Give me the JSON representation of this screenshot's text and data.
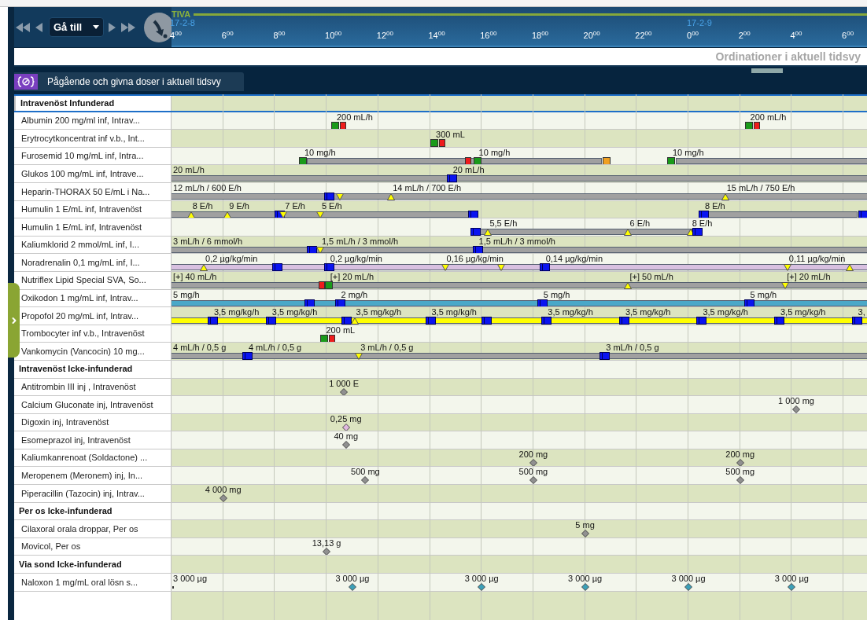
{
  "nav": {
    "goto": "Gå till"
  },
  "timeline": {
    "label": "TIVA",
    "hours": [
      {
        "text": "4$^{00}$",
        "date": "17-2-8"
      },
      {
        "text": "6$^{00}$"
      },
      {
        "text": "8$^{00}$"
      },
      {
        "text": "10$^{00}$"
      },
      {
        "text": "12$^{00}$"
      },
      {
        "text": "14$^{00}$"
      },
      {
        "text": "16$^{00}$"
      },
      {
        "text": "18$^{00}$"
      },
      {
        "text": "20$^{00}$"
      },
      {
        "text": "22$^{00}$"
      },
      {
        "text": "0$^{00}$",
        "date": "17-2-9"
      },
      {
        "text": "2$^{00}$"
      },
      {
        "text": "4$^{00}$"
      },
      {
        "text": "6$^{00}$"
      }
    ]
  },
  "panel_title": "Ordinationer i aktuell tidsvy",
  "tab": {
    "label": "Pågående och givna doser i aktuell tidsvy"
  },
  "sections": [
    {
      "title": "Intravenöst Infunderad",
      "selected": true,
      "rows": [
        {
          "name": "Albumin 200 mg/ml inf, Intrav...",
          "marks": [
            {
              "kind": "start",
              "text": "200 mL/h"
            },
            {
              "kind": "stop"
            },
            {
              "kind": "start",
              "text": "200 mL/h"
            },
            {
              "kind": "stop"
            }
          ]
        },
        {
          "name": "Erytrocytkoncentrat inf v.b., Int...",
          "marks": [
            {
              "kind": "start",
              "text": "300 mL"
            },
            {
              "kind": "stop"
            }
          ]
        },
        {
          "name": "Furosemid 10 mg/mL inf, Intra...",
          "bars": [
            {
              "color": "#a0a0a0"
            },
            {
              "color": "#a0a0a0"
            }
          ],
          "marks": [
            {
              "kind": "start",
              "text": "10 mg/h"
            },
            {
              "kind": "stop"
            },
            {
              "kind": "start",
              "text": "10 mg/h"
            },
            {
              "kind": "end"
            },
            {
              "kind": "start",
              "text": "10 mg/h"
            }
          ]
        },
        {
          "name": "Glukos 100 mg/mL inf, Intrave...",
          "lead": "20 mL/h",
          "bars": [
            {
              "color": "#a0a0a0"
            }
          ],
          "marks": [
            {
              "kind": "change",
              "text": "20 mL/h"
            }
          ]
        },
        {
          "name": "Heparin-THORAX 50 E/mL i Na...",
          "lead": "12 mL/h / 600 E/h",
          "bars": [
            {
              "color": "#a0a0a0"
            }
          ],
          "marks": [
            {
              "kind": "change"
            },
            {
              "kind": "down"
            },
            {
              "kind": "up",
              "text": "14 mL/h / 700 E/h"
            },
            {
              "kind": "up",
              "text": "15 mL/h / 750 E/h"
            }
          ]
        },
        {
          "name": "Humulin 1 E/mL inf, Intravenöst",
          "bars": [
            {
              "color": "#a0a0a0"
            },
            {
              "color": "#a0a0a0"
            }
          ],
          "marks": [
            {
              "kind": "up",
              "text": "8 E/h"
            },
            {
              "kind": "up",
              "text": "9 E/h"
            },
            {
              "kind": "change"
            },
            {
              "kind": "down",
              "text": "7 E/h"
            },
            {
              "kind": "down",
              "text": "5 E/h"
            },
            {
              "kind": "change"
            },
            {
              "kind": "change",
              "text": "8 E/h"
            },
            {
              "kind": "change"
            }
          ]
        },
        {
          "name": "Humulin 1 E/mL inf, Intravenöst",
          "bars": [
            {
              "color": "#a0a0a0"
            }
          ],
          "marks": [
            {
              "kind": "change"
            },
            {
              "kind": "up",
              "text": "5,5 E/h"
            },
            {
              "kind": "up",
              "text": "6 E/h"
            },
            {
              "kind": "up",
              "text": "8 E/h"
            },
            {
              "kind": "change"
            }
          ]
        },
        {
          "name": "Kaliumklorid 2 mmol/mL inf, I...",
          "lead": "3 mL/h / 6 mmol/h",
          "bars": [
            {
              "color": "#a0a0a0"
            }
          ],
          "marks": [
            {
              "kind": "change"
            },
            {
              "kind": "down",
              "text": "1,5 mL/h / 3 mmol/h"
            },
            {
              "kind": "change",
              "text": "1,5 mL/h / 3 mmol/h"
            }
          ]
        },
        {
          "name": "Noradrenalin 0,1 mg/mL inf, I...",
          "bars": [
            {
              "color": "#d8c0e0"
            }
          ],
          "marks": [
            {
              "kind": "up",
              "text": "0,2 µg/kg/min"
            },
            {
              "kind": "change"
            },
            {
              "kind": "change",
              "text": "0,2 µg/kg/min"
            },
            {
              "kind": "down",
              "text": "0,16 µg/kg/min"
            },
            {
              "kind": "down"
            },
            {
              "kind": "change",
              "text": "0,14 µg/kg/min"
            },
            {
              "kind": "down",
              "text": "0,11 µg/kg/min"
            },
            {
              "kind": "up"
            }
          ]
        },
        {
          "name": "Nutriflex Lipid Special SVA, So...",
          "lead": "[+] 40 mL/h",
          "bars": [
            {
              "color": "#a0a0a0"
            }
          ],
          "marks": [
            {
              "kind": "stop"
            },
            {
              "kind": "start",
              "text": "[+] 20 mL/h"
            },
            {
              "kind": "up",
              "text": "[+] 50 mL/h"
            },
            {
              "kind": "down",
              "text": "[+] 20 mL/h"
            }
          ]
        },
        {
          "name": "Oxikodon 1 mg/mL inf, Intrav...",
          "lead": "5 mg/h",
          "bars": [
            {
              "color": "#4aa8c8"
            }
          ],
          "marks": [
            {
              "kind": "change"
            },
            {
              "kind": "change",
              "text": "2 mg/h"
            },
            {
              "kind": "change",
              "text": "5 mg/h"
            },
            {
              "kind": "change",
              "text": "5 mg/h"
            }
          ]
        },
        {
          "name": "Propofol 20 mg/mL inf, Intrav...",
          "bars": [
            {
              "color": "#ffff00"
            }
          ],
          "marks": [
            {
              "kind": "change",
              "text": "3,5 mg/kg/h"
            },
            {
              "kind": "change",
              "text": "3,5 mg/kg/h"
            },
            {
              "kind": "change"
            },
            {
              "kind": "up",
              "text": "3,5 mg/kg/h"
            },
            {
              "kind": "change",
              "text": "3,5 mg/kg/h"
            },
            {
              "kind": "change"
            },
            {
              "kind": "change",
              "text": "3,5 mg/kg/h"
            },
            {
              "kind": "change",
              "text": "3,5 mg/kg/h"
            },
            {
              "kind": "change",
              "text": "3,5 mg/kg/h"
            },
            {
              "kind": "change",
              "text": "3,5 mg/kg/h"
            },
            {
              "kind": "change",
              "text": "3,"
            }
          ]
        },
        {
          "name": "Trombocyter inf v.b., Intravenöst",
          "marks": [
            {
              "kind": "start",
              "text": "200 mL"
            },
            {
              "kind": "stop"
            }
          ]
        },
        {
          "name": "Vankomycin (Vancocin) 10 mg...",
          "lead": "4 mL/h / 0,5 g",
          "bars": [
            {
              "color": "#a0a0a0"
            }
          ],
          "marks": [
            {
              "kind": "change",
              "text": "4 mL/h / 0,5 g"
            },
            {
              "kind": "down",
              "text": "3 mL/h / 0,5 g"
            },
            {
              "kind": "change",
              "text": "3 mL/h / 0,5 g"
            }
          ]
        }
      ]
    },
    {
      "title": "Intravenöst Icke-infunderad",
      "selected": false,
      "rows": [
        {
          "name": "Antitrombin III inj , Intravenöst",
          "marks": [
            {
              "kind": "dose",
              "color": "#909090",
              "text": "1 000 E"
            }
          ]
        },
        {
          "name": "Calcium Gluconate inj, Intravenöst",
          "marks": [
            {
              "kind": "dose",
              "color": "#909090",
              "text": "1 000 mg"
            }
          ]
        },
        {
          "name": "Digoxin inj, Intravenöst",
          "marks": [
            {
              "kind": "dose",
              "color": "#e0b8e0",
              "text": "0,25 mg"
            }
          ]
        },
        {
          "name": "Esomeprazol inj, Intravenöst",
          "marks": [
            {
              "kind": "dose",
              "color": "#909090",
              "text": "40 mg"
            }
          ]
        },
        {
          "name": "Kaliumkanrenoat (Soldactone) ...",
          "marks": [
            {
              "kind": "dose",
              "color": "#909090",
              "text": "200 mg"
            },
            {
              "kind": "dose",
              "color": "#909090",
              "text": "200 mg"
            }
          ]
        },
        {
          "name": "Meropenem (Meronem) inj, In...",
          "marks": [
            {
              "kind": "dose",
              "color": "#909090",
              "text": "500 mg"
            },
            {
              "kind": "dose",
              "color": "#909090",
              "text": "500 mg"
            },
            {
              "kind": "dose",
              "color": "#909090",
              "text": "500 mg"
            }
          ]
        },
        {
          "name": "Piperacillin (Tazocin) inj, Intrav...",
          "marks": [
            {
              "kind": "dose",
              "color": "#909090",
              "text": "4 000 mg"
            }
          ]
        }
      ]
    },
    {
      "title": "Per os Icke-infunderad",
      "selected": false,
      "rows": [
        {
          "name": "Cilaxoral orala droppar, Per os",
          "marks": [
            {
              "kind": "dose",
              "color": "#909090",
              "text": "5 mg"
            }
          ]
        },
        {
          "name": "Movicol, Per os",
          "marks": [
            {
              "kind": "dose",
              "color": "#909090",
              "text": "13,13 g"
            }
          ]
        }
      ]
    },
    {
      "title": "Via sond Icke-infunderad",
      "selected": false,
      "rows": [
        {
          "name": "Naloxon 1 mg/mL oral lösn s...",
          "marks": [
            {
              "kind": "dot",
              "text": "3 000 µg"
            },
            {
              "kind": "dose",
              "color": "#3ca0b8",
              "text": "3 000 µg"
            },
            {
              "kind": "dose",
              "color": "#3ca0b8",
              "text": "3 000 µg"
            },
            {
              "kind": "dose",
              "color": "#3ca0b8",
              "text": "3 000 µg"
            },
            {
              "kind": "dose",
              "color": "#3ca0b8",
              "text": "3 000 µg"
            },
            {
              "kind": "dose",
              "color": "#3ca0b8",
              "text": "3 000 µg"
            }
          ]
        }
      ]
    }
  ]
}
